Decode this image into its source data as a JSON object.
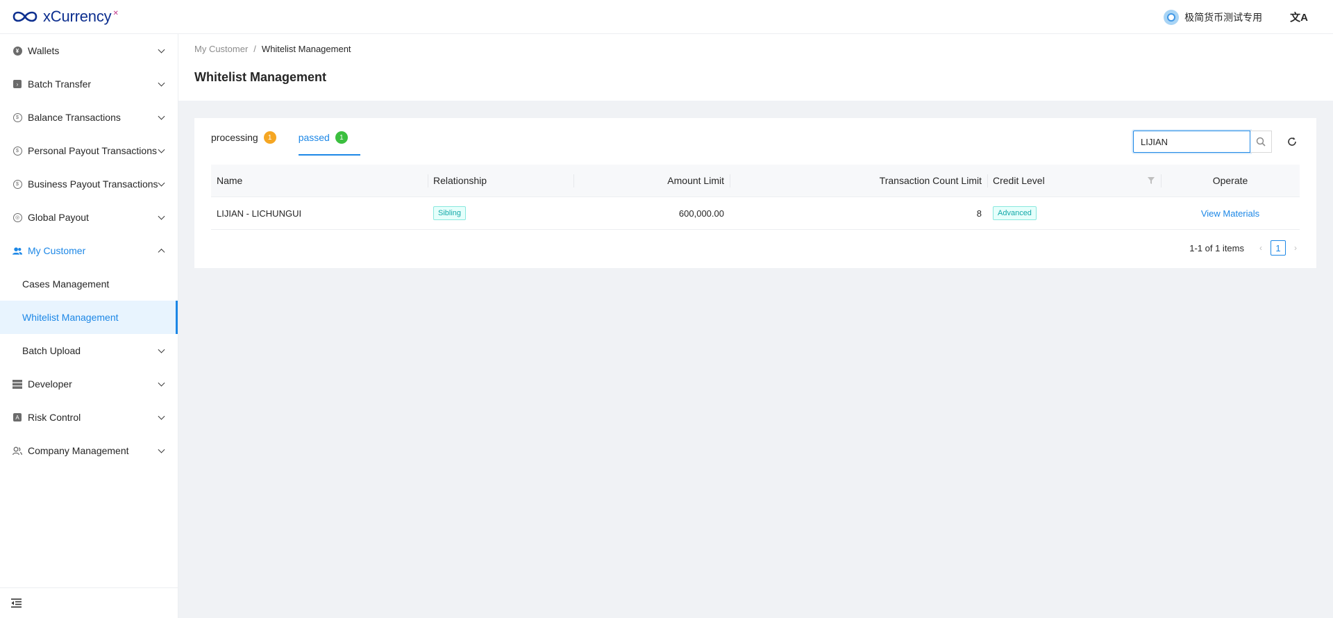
{
  "app": {
    "logo_text": "xCurrency",
    "logo_sup": "✕"
  },
  "header": {
    "user_name": "极简货币测试专用",
    "lang_icon": "文A"
  },
  "sidebar": {
    "items": [
      {
        "label": "Wallets",
        "icon": "wallet-icon"
      },
      {
        "label": "Batch Transfer",
        "icon": "batch-transfer-icon"
      },
      {
        "label": "Balance Transactions",
        "icon": "balance-icon"
      },
      {
        "label": "Personal Payout Transactions",
        "icon": "personal-payout-icon"
      },
      {
        "label": "Business Payout Transactions",
        "icon": "business-payout-icon"
      },
      {
        "label": "Global Payout",
        "icon": "global-payout-icon"
      },
      {
        "label": "My Customer",
        "icon": "customer-icon"
      },
      {
        "label": "Cases Management"
      },
      {
        "label": "Whitelist Management"
      },
      {
        "label": "Batch Upload"
      },
      {
        "label": "Developer",
        "icon": "developer-icon"
      },
      {
        "label": "Risk Control",
        "icon": "risk-control-icon"
      },
      {
        "label": "Company Management",
        "icon": "company-icon"
      }
    ]
  },
  "breadcrumb": {
    "parent": "My Customer",
    "sep": "/",
    "current": "Whitelist Management"
  },
  "page": {
    "title": "Whitelist Management"
  },
  "tabs": [
    {
      "label": "processing",
      "count": "1",
      "color": "#f5a623"
    },
    {
      "label": "passed",
      "count": "1",
      "color": "#3bbf3f"
    }
  ],
  "search": {
    "value": "LIJIAN"
  },
  "table": {
    "headers": {
      "name": "Name",
      "relationship": "Relationship",
      "amount_limit": "Amount Limit",
      "tx_count_limit": "Transaction Count Limit",
      "credit_level": "Credit Level",
      "operate": "Operate"
    },
    "rows": [
      {
        "name": "LIJIAN - LICHUNGUI",
        "relationship": "Sibling",
        "amount_limit": "600,000.00",
        "tx_count_limit": "8",
        "credit_level": "Advanced",
        "operate": "View Materials"
      }
    ]
  },
  "pagination": {
    "total_text": "1-1 of 1 items",
    "current": "1"
  },
  "colors": {
    "accent": "#1c87e6",
    "tag_cyan": "#13a8a8"
  }
}
